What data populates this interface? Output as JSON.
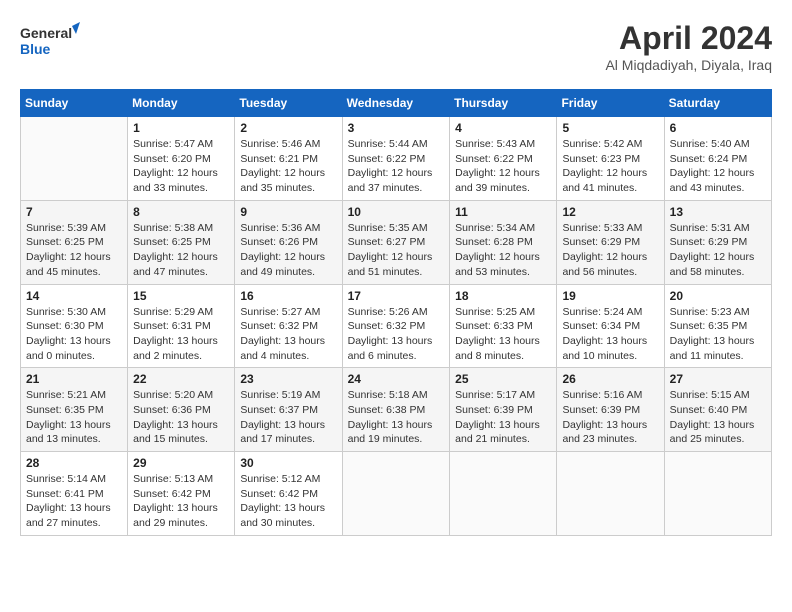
{
  "header": {
    "logo_line1": "General",
    "logo_line2": "Blue",
    "month_title": "April 2024",
    "location": "Al Miqdadiyah, Diyala, Iraq"
  },
  "weekdays": [
    "Sunday",
    "Monday",
    "Tuesday",
    "Wednesday",
    "Thursday",
    "Friday",
    "Saturday"
  ],
  "weeks": [
    [
      {
        "day": "",
        "info": ""
      },
      {
        "day": "1",
        "info": "Sunrise: 5:47 AM\nSunset: 6:20 PM\nDaylight: 12 hours\nand 33 minutes."
      },
      {
        "day": "2",
        "info": "Sunrise: 5:46 AM\nSunset: 6:21 PM\nDaylight: 12 hours\nand 35 minutes."
      },
      {
        "day": "3",
        "info": "Sunrise: 5:44 AM\nSunset: 6:22 PM\nDaylight: 12 hours\nand 37 minutes."
      },
      {
        "day": "4",
        "info": "Sunrise: 5:43 AM\nSunset: 6:22 PM\nDaylight: 12 hours\nand 39 minutes."
      },
      {
        "day": "5",
        "info": "Sunrise: 5:42 AM\nSunset: 6:23 PM\nDaylight: 12 hours\nand 41 minutes."
      },
      {
        "day": "6",
        "info": "Sunrise: 5:40 AM\nSunset: 6:24 PM\nDaylight: 12 hours\nand 43 minutes."
      }
    ],
    [
      {
        "day": "7",
        "info": "Sunrise: 5:39 AM\nSunset: 6:25 PM\nDaylight: 12 hours\nand 45 minutes."
      },
      {
        "day": "8",
        "info": "Sunrise: 5:38 AM\nSunset: 6:25 PM\nDaylight: 12 hours\nand 47 minutes."
      },
      {
        "day": "9",
        "info": "Sunrise: 5:36 AM\nSunset: 6:26 PM\nDaylight: 12 hours\nand 49 minutes."
      },
      {
        "day": "10",
        "info": "Sunrise: 5:35 AM\nSunset: 6:27 PM\nDaylight: 12 hours\nand 51 minutes."
      },
      {
        "day": "11",
        "info": "Sunrise: 5:34 AM\nSunset: 6:28 PM\nDaylight: 12 hours\nand 53 minutes."
      },
      {
        "day": "12",
        "info": "Sunrise: 5:33 AM\nSunset: 6:29 PM\nDaylight: 12 hours\nand 56 minutes."
      },
      {
        "day": "13",
        "info": "Sunrise: 5:31 AM\nSunset: 6:29 PM\nDaylight: 12 hours\nand 58 minutes."
      }
    ],
    [
      {
        "day": "14",
        "info": "Sunrise: 5:30 AM\nSunset: 6:30 PM\nDaylight: 13 hours\nand 0 minutes."
      },
      {
        "day": "15",
        "info": "Sunrise: 5:29 AM\nSunset: 6:31 PM\nDaylight: 13 hours\nand 2 minutes."
      },
      {
        "day": "16",
        "info": "Sunrise: 5:27 AM\nSunset: 6:32 PM\nDaylight: 13 hours\nand 4 minutes."
      },
      {
        "day": "17",
        "info": "Sunrise: 5:26 AM\nSunset: 6:32 PM\nDaylight: 13 hours\nand 6 minutes."
      },
      {
        "day": "18",
        "info": "Sunrise: 5:25 AM\nSunset: 6:33 PM\nDaylight: 13 hours\nand 8 minutes."
      },
      {
        "day": "19",
        "info": "Sunrise: 5:24 AM\nSunset: 6:34 PM\nDaylight: 13 hours\nand 10 minutes."
      },
      {
        "day": "20",
        "info": "Sunrise: 5:23 AM\nSunset: 6:35 PM\nDaylight: 13 hours\nand 11 minutes."
      }
    ],
    [
      {
        "day": "21",
        "info": "Sunrise: 5:21 AM\nSunset: 6:35 PM\nDaylight: 13 hours\nand 13 minutes."
      },
      {
        "day": "22",
        "info": "Sunrise: 5:20 AM\nSunset: 6:36 PM\nDaylight: 13 hours\nand 15 minutes."
      },
      {
        "day": "23",
        "info": "Sunrise: 5:19 AM\nSunset: 6:37 PM\nDaylight: 13 hours\nand 17 minutes."
      },
      {
        "day": "24",
        "info": "Sunrise: 5:18 AM\nSunset: 6:38 PM\nDaylight: 13 hours\nand 19 minutes."
      },
      {
        "day": "25",
        "info": "Sunrise: 5:17 AM\nSunset: 6:39 PM\nDaylight: 13 hours\nand 21 minutes."
      },
      {
        "day": "26",
        "info": "Sunrise: 5:16 AM\nSunset: 6:39 PM\nDaylight: 13 hours\nand 23 minutes."
      },
      {
        "day": "27",
        "info": "Sunrise: 5:15 AM\nSunset: 6:40 PM\nDaylight: 13 hours\nand 25 minutes."
      }
    ],
    [
      {
        "day": "28",
        "info": "Sunrise: 5:14 AM\nSunset: 6:41 PM\nDaylight: 13 hours\nand 27 minutes."
      },
      {
        "day": "29",
        "info": "Sunrise: 5:13 AM\nSunset: 6:42 PM\nDaylight: 13 hours\nand 29 minutes."
      },
      {
        "day": "30",
        "info": "Sunrise: 5:12 AM\nSunset: 6:42 PM\nDaylight: 13 hours\nand 30 minutes."
      },
      {
        "day": "",
        "info": ""
      },
      {
        "day": "",
        "info": ""
      },
      {
        "day": "",
        "info": ""
      },
      {
        "day": "",
        "info": ""
      }
    ]
  ]
}
